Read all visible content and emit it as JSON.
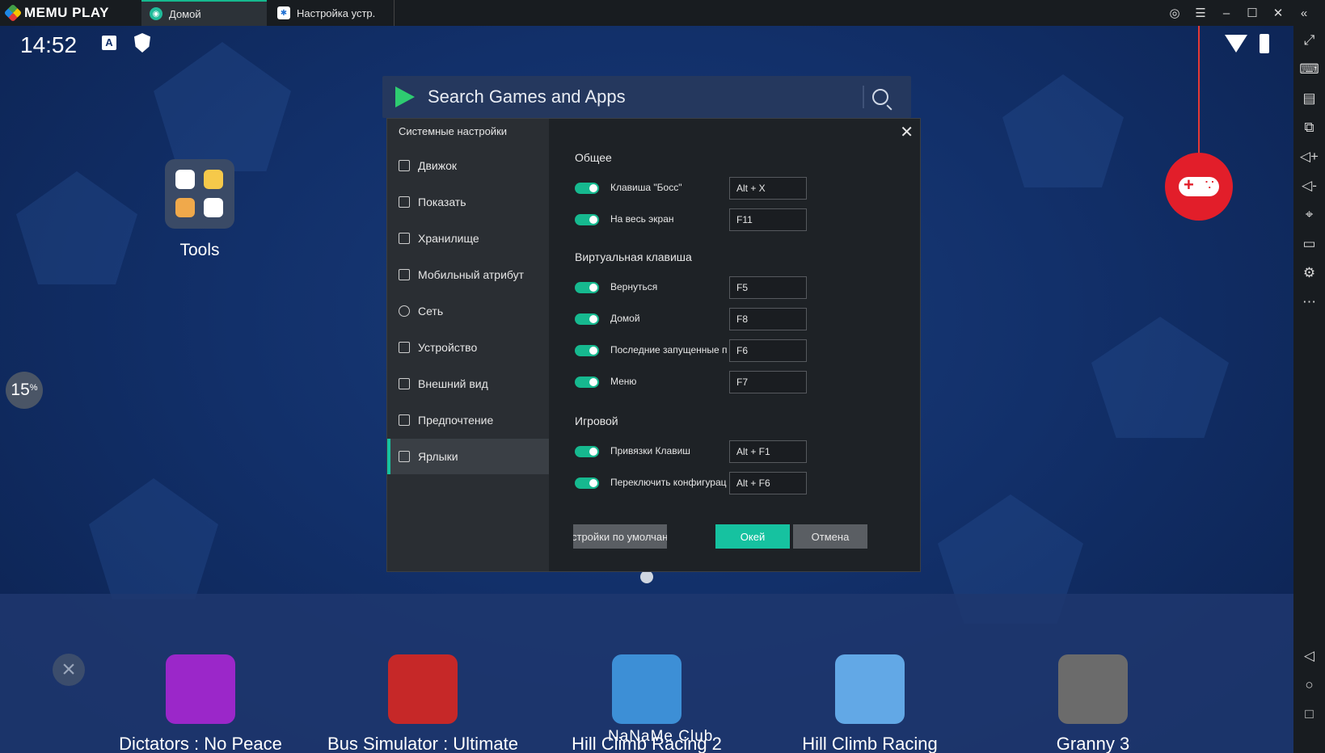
{
  "titlebar": {
    "logo_text": "MEMU PLAY",
    "tabs": [
      {
        "label": "Домой"
      },
      {
        "label": "Настройка устр."
      }
    ]
  },
  "statusbar": {
    "time": "14:52",
    "a_badge": "A"
  },
  "search": {
    "placeholder": "Search Games and Apps"
  },
  "home": {
    "folder_label": "Tools",
    "progress_value": "15",
    "progress_unit": "%"
  },
  "dock": {
    "apps": [
      {
        "label": "Dictators : No Peace",
        "color": "#9b27c9"
      },
      {
        "label": "Bus Simulator : Ultimate",
        "color": "#c62828"
      },
      {
        "label": "Hill Climb Racing 2",
        "color": "#3d8fd6"
      },
      {
        "label": "Hill Climb Racing",
        "color": "#62a8e6"
      },
      {
        "label": "Granny 3",
        "color": "#6b6b6b"
      }
    ],
    "watermark": "NaNaMe Club"
  },
  "dialog": {
    "title": "Системные настройки",
    "nav": [
      {
        "label": "Движок",
        "icon": "chip-icon"
      },
      {
        "label": "Показать",
        "icon": "monitor-icon"
      },
      {
        "label": "Хранилище",
        "icon": "storage-icon"
      },
      {
        "label": "Мобильный атрибут",
        "icon": "tag-icon"
      },
      {
        "label": "Сеть",
        "icon": "globe-icon"
      },
      {
        "label": "Устройство",
        "icon": "microphone-icon"
      },
      {
        "label": "Внешний вид",
        "icon": "window-icon"
      },
      {
        "label": "Предпочтение",
        "icon": "wrench-icon"
      },
      {
        "label": "Ярлыки",
        "icon": "keyboard-icon",
        "active": true
      }
    ],
    "sections": {
      "general": {
        "title": "Общее",
        "rows": [
          {
            "label": "Клавиша \"Босс\"",
            "value": "Alt + X",
            "enabled": true
          },
          {
            "label": "На весь экран",
            "value": "F11",
            "enabled": true
          }
        ]
      },
      "virtual": {
        "title": "Виртуальная клавиша",
        "rows": [
          {
            "label": "Вернуться",
            "value": "F5",
            "enabled": true
          },
          {
            "label": "Домой",
            "value": "F8",
            "enabled": true
          },
          {
            "label": "Последние запущенные пр",
            "value": "F6",
            "enabled": true
          },
          {
            "label": "Меню",
            "value": "F7",
            "enabled": true
          }
        ]
      },
      "game": {
        "title": "Игровой",
        "rows": [
          {
            "label": "Привязки Клавиш",
            "value": "Alt + F1",
            "enabled": true
          },
          {
            "label": "Переключить конфигурац",
            "value": "Alt + F6",
            "enabled": true
          }
        ]
      }
    },
    "buttons": {
      "default": "стройки по умолчани",
      "ok": "Окей",
      "cancel": "Отмена"
    }
  },
  "colors": {
    "accent": "#16c2a0",
    "gamepad": "#e21e2a",
    "background": "#12306a"
  }
}
